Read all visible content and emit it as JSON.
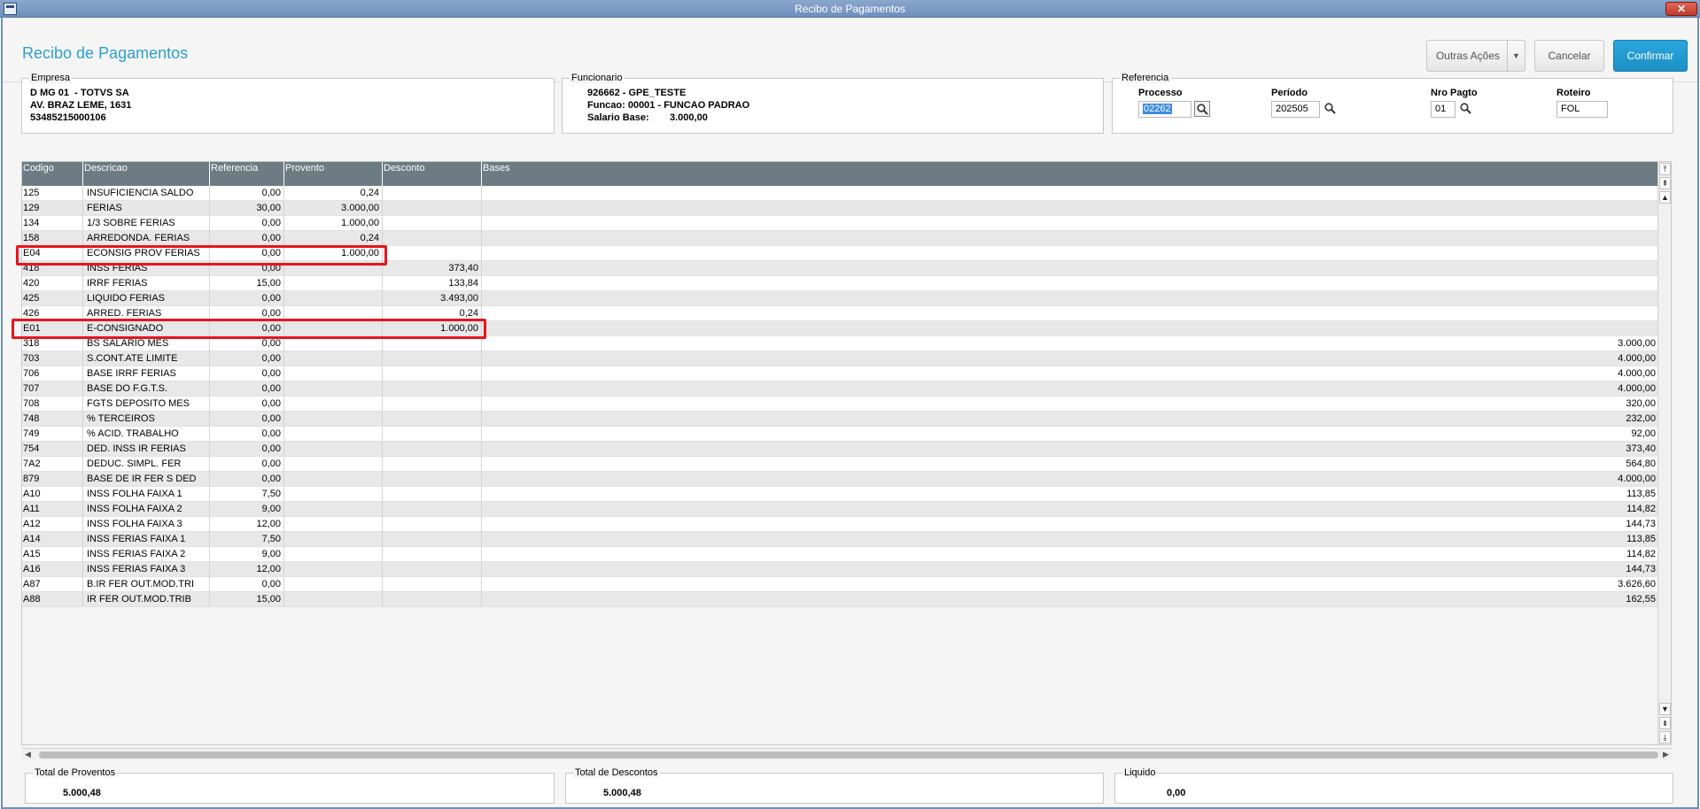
{
  "window": {
    "title": "Recibo de Pagamentos",
    "close_label": "✕"
  },
  "page": {
    "title": "Recibo de Pagamentos"
  },
  "actions": {
    "outras": "Outras Ações",
    "cancelar": "Cancelar",
    "confirmar": "Confirmar"
  },
  "empresa": {
    "legend": "Empresa",
    "line1": "D MG 01  - TOTVS SA",
    "line2": "AV. BRAZ LEME, 1631",
    "line3": "53485215000106"
  },
  "funcionario": {
    "legend": "Funcionario",
    "line1": "926662 - GPE_TESTE",
    "line2": "Funcao: 00001 - FUNCAO PADRAO",
    "salario_label": "Salario Base:",
    "salario_value": "3.000,00"
  },
  "referencia": {
    "legend": "Referencia",
    "processo_label": "Processo",
    "processo_value": "02262",
    "periodo_label": "Período",
    "periodo_value": "202505",
    "nropagto_label": "Nro Pagto",
    "nropagto_value": "01",
    "roteiro_label": "Roteiro",
    "roteiro_value": "FOL"
  },
  "grid": {
    "headers": [
      "Codigo",
      "Descricao",
      "Referencia",
      "Provento",
      "Desconto",
      "Bases"
    ],
    "rows": [
      [
        "125",
        "INSUFICIENCIA  SALDO",
        "0,00",
        "0,24",
        "",
        ""
      ],
      [
        "129",
        "FERIAS",
        "30,00",
        "3.000,00",
        "",
        ""
      ],
      [
        "134",
        "1/3 SOBRE FERIAS",
        "0,00",
        "1.000,00",
        "",
        ""
      ],
      [
        "158",
        "ARREDONDA. FERIAS",
        "0,00",
        "0,24",
        "",
        ""
      ],
      [
        "E04",
        "ECONSIG PROV FERIAS",
        "0,00",
        "1.000,00",
        "",
        ""
      ],
      [
        "418",
        "INSS FERIAS",
        "0,00",
        "",
        "373,40",
        ""
      ],
      [
        "420",
        "IRRF FERIAS",
        "15,00",
        "",
        "133,84",
        ""
      ],
      [
        "425",
        "LIQUIDO FERIAS",
        "0,00",
        "",
        "3.493,00",
        ""
      ],
      [
        "426",
        "ARRED. FERIAS",
        "0,00",
        "",
        "0,24",
        ""
      ],
      [
        "E01",
        "E-CONSIGNADO",
        "0,00",
        "",
        "1.000,00",
        ""
      ],
      [
        "318",
        "BS SALARIO MES",
        "0,00",
        "",
        "",
        "3.000,00"
      ],
      [
        "703",
        "S.CONT.ATE LIMITE",
        "0,00",
        "",
        "",
        "4.000,00"
      ],
      [
        "706",
        "BASE IRRF FERIAS",
        "0,00",
        "",
        "",
        "4.000,00"
      ],
      [
        "707",
        "BASE DO F.G.T.S.",
        "0,00",
        "",
        "",
        "4.000,00"
      ],
      [
        "708",
        "FGTS DEPOSITO MES",
        "0,00",
        "",
        "",
        "320,00"
      ],
      [
        "748",
        "% TERCEIROS",
        "0,00",
        "",
        "",
        "232,00"
      ],
      [
        "749",
        "% ACID. TRABALHO",
        "0,00",
        "",
        "",
        "92,00"
      ],
      [
        "754",
        "DED. INSS IR FERIAS",
        "0,00",
        "",
        "",
        "373,40"
      ],
      [
        "7A2",
        "DEDUC. SIMPL. FER",
        "0,00",
        "",
        "",
        "564,80"
      ],
      [
        "879",
        "BASE DE IR FER S DED",
        "0,00",
        "",
        "",
        "4.000,00"
      ],
      [
        "A10",
        "INSS FOLHA FAIXA 1",
        "7,50",
        "",
        "",
        "113,85"
      ],
      [
        "A11",
        "INSS FOLHA FAIXA 2",
        "9,00",
        "",
        "",
        "114,82"
      ],
      [
        "A12",
        "INSS FOLHA FAIXA 3",
        "12,00",
        "",
        "",
        "144,73"
      ],
      [
        "A14",
        "INSS FERIAS FAIXA 1",
        "7,50",
        "",
        "",
        "113,85"
      ],
      [
        "A15",
        "INSS FERIAS FAIXA 2",
        "9,00",
        "",
        "",
        "114,82"
      ],
      [
        "A16",
        "INSS FERIAS FAIXA 3",
        "12,00",
        "",
        "",
        "144,73"
      ],
      [
        "A87",
        "B.IR FER OUT.MOD.TRI",
        "0,00",
        "",
        "",
        "3.626,60"
      ],
      [
        "A88",
        "IR FER OUT.MOD.TRIB",
        "15,00",
        "",
        "",
        "162,55"
      ]
    ]
  },
  "totals": {
    "proventos_label": "Total de Proventos",
    "proventos_value": "5.000,48",
    "descontos_label": "Total de Descontos",
    "descontos_value": "5.000,48",
    "liquido_label": "Liquido",
    "liquido_value": "0,00"
  },
  "colors": {
    "accent": "#2d9fd0",
    "confirm": "#1c8fc6",
    "grid_header": "#6c7c82",
    "highlight": "#e8141e"
  },
  "icons": [
    "window-icon",
    "close-icon",
    "search-icon",
    "chevron-down-icon",
    "scroll-top-icon",
    "scroll-up-icon",
    "scroll-down-icon",
    "scroll-bottom-icon"
  ]
}
